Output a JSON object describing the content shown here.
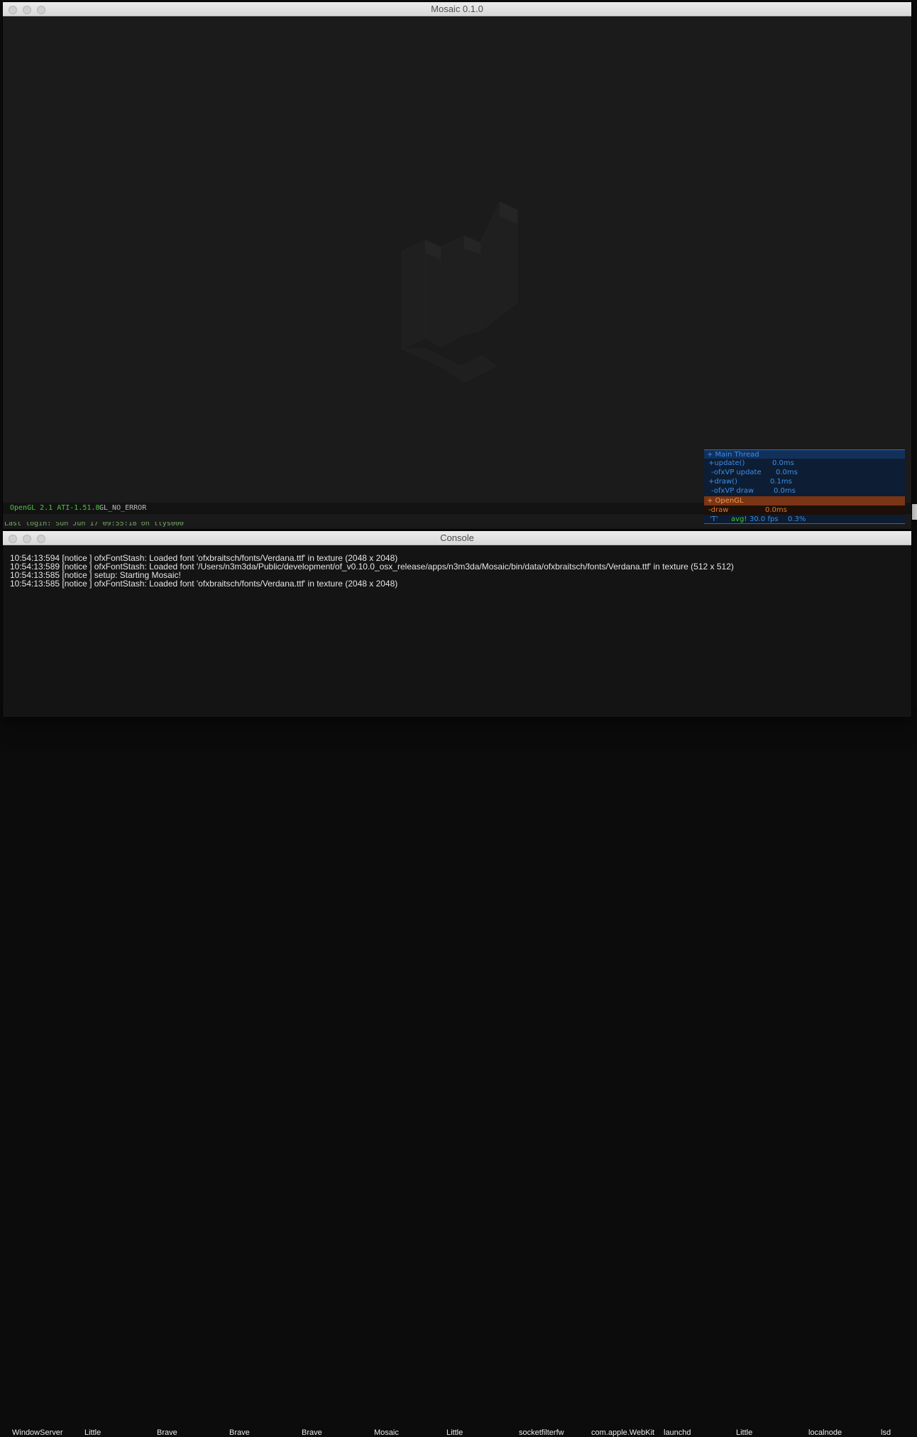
{
  "mosaic_window": {
    "title": "Mosaic 0.1.0",
    "status": {
      "gl_version": "OpenGL 2.1 ATI-1.51.8",
      "gl_error": "GL_NO_ERROR"
    },
    "terminal_ghost": "Last login: Sun Jun 17 09:55:18 on ttys000"
  },
  "profiler": {
    "main_thread": "+ Main Thread",
    "rows": [
      {
        "name": "+update()",
        "value": "0.0ms"
      },
      {
        "name": "-ofxVP update",
        "value": "0.0ms"
      },
      {
        "name": "+draw()",
        "value": "0.1ms"
      },
      {
        "name": "-ofxVP draw",
        "value": "0.0ms"
      }
    ],
    "opengl": "+ OpenGL",
    "gl_row": {
      "name": "-draw",
      "value": "0.0ms"
    },
    "footer": {
      "key": "'T'",
      "avg_label": "avg!",
      "fps": "30.0 fps",
      "pct": "0.3%"
    }
  },
  "console_window": {
    "title": "Console",
    "lines": [
      "10:54:13:594 [notice ] ofxFontStash: Loaded font 'ofxbraitsch/fonts/Verdana.ttf' in texture (2048 x 2048)",
      "10:54:13:589 [notice ] ofxFontStash: Loaded font '/Users/n3m3da/Public/development/of_v0.10.0_osx_release/apps/n3m3da/Mosaic/bin/data/ofxbraitsch/fonts/Verdana.ttf' in texture (512 x 512)",
      "10:54:13:585 [notice ] setup: Starting Mosaic!",
      "10:54:13:585 [notice ] ofxFontStash: Loaded font 'ofxbraitsch/fonts/Verdana.ttf' in texture (2048 x 2048)"
    ]
  },
  "process_strip": {
    "items": [
      "WindowServer",
      "Little",
      "Brave",
      "Brave",
      "Brave",
      "Mosaic",
      "Little",
      "socketfilterfw",
      "com.apple.WebKit",
      "launchd",
      "Little",
      "localnode",
      "lsd"
    ]
  },
  "colors": {
    "gl_green": "#46c93c",
    "profiler_blue": "#3b8fe9",
    "profiler_orange": "#f09a4c"
  }
}
